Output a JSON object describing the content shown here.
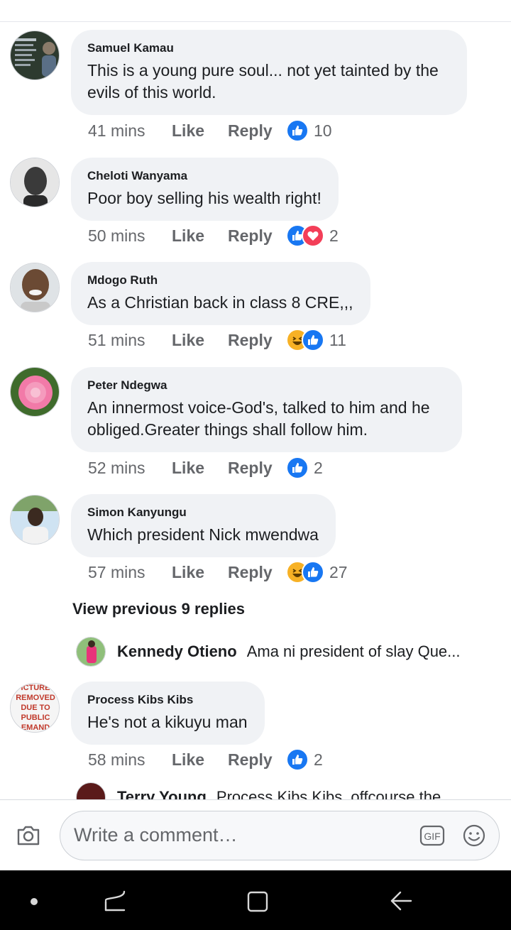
{
  "comments": [
    {
      "author": "Samuel Kamau",
      "text": "This is a young pure soul... not yet tainted by the evils of this world.",
      "time": "41 mins",
      "like_label": "Like",
      "reply_label": "Reply",
      "reactions": [
        "like"
      ],
      "reaction_count": "10"
    },
    {
      "author": "Cheloti Wanyama",
      "text": "Poor boy selling his wealth right!",
      "time": "50 mins",
      "like_label": "Like",
      "reply_label": "Reply",
      "reactions": [
        "like",
        "love"
      ],
      "reaction_count": "2"
    },
    {
      "author": "Mdogo Ruth",
      "text": "As a Christian back in class 8 CRE,,,",
      "time": "51 mins",
      "like_label": "Like",
      "reply_label": "Reply",
      "reactions": [
        "haha",
        "like"
      ],
      "reaction_count": "11"
    },
    {
      "author": "Peter Ndegwa",
      "text": "An innermost voice-God's, talked to him and he obliged.Greater things shall follow him.",
      "time": "52 mins",
      "like_label": "Like",
      "reply_label": "Reply",
      "reactions": [
        "like"
      ],
      "reaction_count": "2"
    },
    {
      "author": "Simon Kanyungu",
      "text": "Which president Nick mwendwa",
      "time": "57 mins",
      "like_label": "Like",
      "reply_label": "Reply",
      "reactions": [
        "haha",
        "like"
      ],
      "reaction_count": "27"
    },
    {
      "author": "Process Kibs Kibs",
      "text": "He's not a kikuyu man",
      "time": "58 mins",
      "like_label": "Like",
      "reply_label": "Reply",
      "reactions": [
        "like"
      ],
      "reaction_count": "2"
    }
  ],
  "view_previous_replies": "View previous 9 replies",
  "nested_reply": {
    "author": "Kennedy Otieno",
    "text": "Ama ni president of slay Que..."
  },
  "cut_reply": {
    "author": "Terry Young",
    "text": "Process Kibs Kibs, offcourse the"
  },
  "removed_avatar_text": "PICTURE REMOVED DUE TO PUBLIC DEMAND",
  "composer": {
    "placeholder": "Write a comment…",
    "gif_label": "GIF"
  },
  "colors": {
    "like_blue": "#1877f2",
    "love_red": "#f33e58",
    "haha_yellow": "#f7b125",
    "bubble_bg": "#f0f2f5"
  }
}
